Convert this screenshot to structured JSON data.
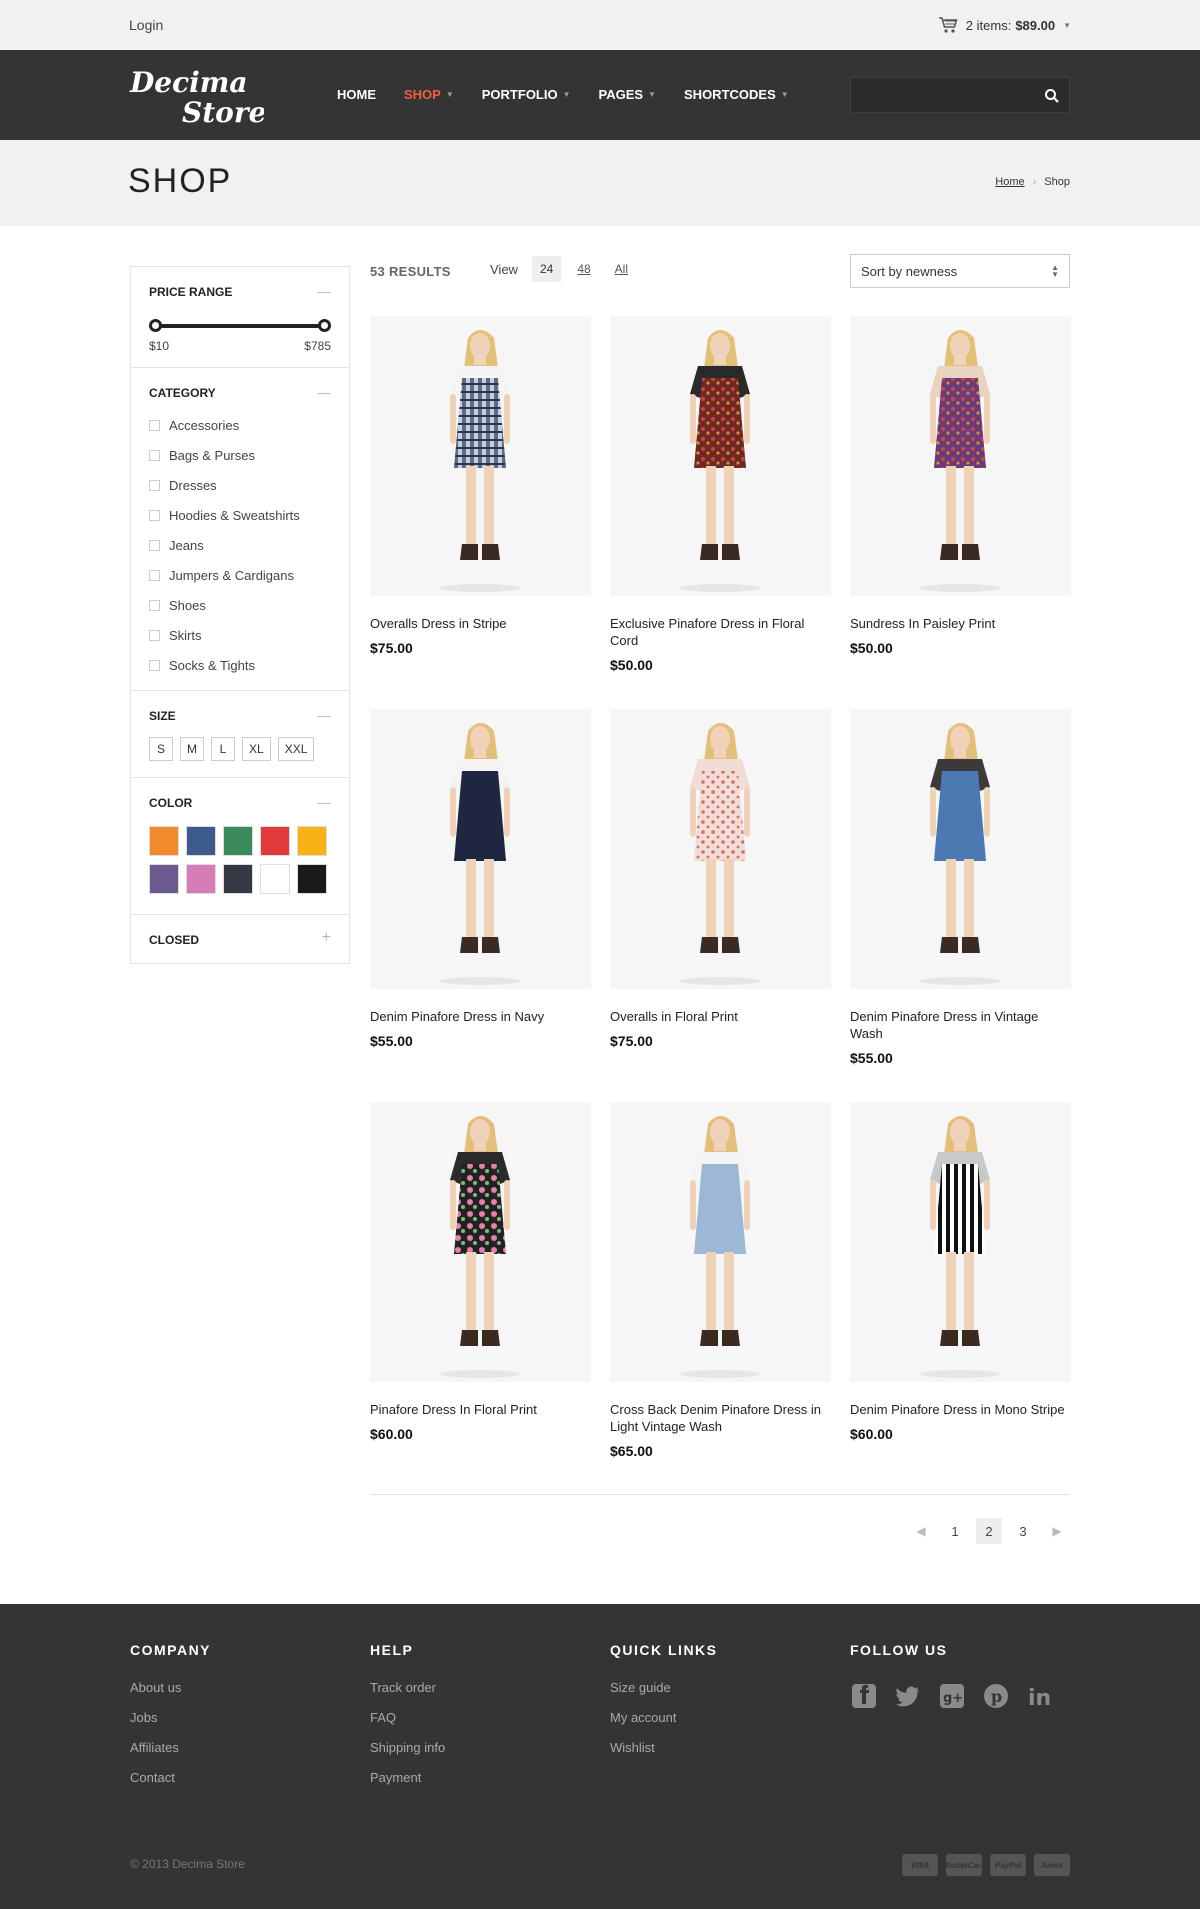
{
  "topbar": {
    "login": "Login",
    "cart_label": "2 items:",
    "cart_total": "$89.00"
  },
  "nav": {
    "logo_line1": "Decima",
    "logo_line2": "Store",
    "items": [
      {
        "label": "HOME",
        "dropdown": false
      },
      {
        "label": "SHOP",
        "dropdown": true
      },
      {
        "label": "PORTFOLIO",
        "dropdown": true
      },
      {
        "label": "PAGES",
        "dropdown": true
      },
      {
        "label": "SHORTCODES",
        "dropdown": true
      }
    ],
    "search_placeholder": "",
    "accent": "#f0603c"
  },
  "page": {
    "title": "SHOP",
    "breadcrumb": [
      "Home",
      "Shop"
    ]
  },
  "sidebar": {
    "price": {
      "title": "PRICE RANGE",
      "min": "$10",
      "max": "$785"
    },
    "category": {
      "title": "CATEGORY",
      "items": [
        "Accessories",
        "Bags & Purses",
        "Dresses",
        "Hoodies & Sweatshirts",
        "Jeans",
        "Jumpers & Cardigans",
        "Shoes",
        "Skirts",
        "Socks & Tights"
      ]
    },
    "size": {
      "title": "SIZE",
      "options": [
        "S",
        "M",
        "L",
        "XL",
        "XXL"
      ]
    },
    "color": {
      "title": "COLOR",
      "swatches": [
        "#f28a2c",
        "#3e5b8e",
        "#3b8a5a",
        "#e03a3a",
        "#f7b217",
        "#6b5a8f",
        "#d67bb5",
        "#333a45",
        "#ffffff",
        "#1a1a1a"
      ]
    },
    "closed": {
      "title": "CLOSED"
    }
  },
  "toolbar": {
    "results": "53 RESULTS",
    "view_label": "View",
    "view_options": [
      "24",
      "48",
      "All"
    ],
    "sort": "Sort by newness"
  },
  "products": [
    {
      "name": "Overalls Dress in Stripe",
      "price": "$75.00",
      "dress": "#5b6a8a",
      "top": "#f4f4f4",
      "pattern": "check"
    },
    {
      "name": "Exclusive Pinafore Dress in Floral Cord",
      "price": "$50.00",
      "dress": "#6e2a22",
      "top": "#2a2a2a",
      "pattern": "floral"
    },
    {
      "name": "Sundress In Paisley Print",
      "price": "$50.00",
      "dress": "#6a3b7a",
      "top": "#e8d2c0",
      "pattern": "floral"
    },
    {
      "name": "Denim Pinafore Dress in Navy",
      "price": "$55.00",
      "dress": "#1f2640",
      "top": "#f4f4f4",
      "pattern": "plain"
    },
    {
      "name": "Overalls in Floral Print",
      "price": "$75.00",
      "dress": "#f1dcd6",
      "top": "#f1dcd6",
      "pattern": "floral-light"
    },
    {
      "name": "Denim Pinafore Dress in Vintage Wash",
      "price": "$55.00",
      "dress": "#4d79b3",
      "top": "#3a3a3a",
      "pattern": "plain"
    },
    {
      "name": "Pinafore Dress In Floral Print",
      "price": "$60.00",
      "dress": "#2b2b2b",
      "top": "#2b2b2b",
      "pattern": "floral-pink"
    },
    {
      "name": "Cross Back Denim Pinafore Dress in Light Vintage Wash",
      "price": "$65.00",
      "dress": "#9db8d6",
      "top": "#f4f4f4",
      "pattern": "plain"
    },
    {
      "name": "Denim Pinafore Dress in Mono Stripe",
      "price": "$60.00",
      "dress": "#222222",
      "top": "#c9c9c9",
      "pattern": "stripe"
    }
  ],
  "pagination": {
    "pages": [
      "1",
      "2",
      "3"
    ],
    "current": "2"
  },
  "footer": {
    "columns": [
      {
        "title": "COMPANY",
        "links": [
          "About us",
          "Jobs",
          "Affiliates",
          "Contact"
        ]
      },
      {
        "title": "HELP",
        "links": [
          "Track order",
          "FAQ",
          "Shipping info",
          "Payment"
        ]
      },
      {
        "title": "QUICK LINKS",
        "links": [
          "Size guide",
          "My account",
          "Wishlist"
        ]
      },
      {
        "title": "FOLLOW US",
        "links": []
      }
    ],
    "socials": [
      "facebook-icon",
      "twitter-icon",
      "google-plus-icon",
      "pinterest-icon",
      "linkedin-icon"
    ],
    "copyright": "© 2013 Decima Store",
    "payments": [
      "VISA",
      "MasterCard",
      "PayPal",
      "Amex"
    ]
  }
}
